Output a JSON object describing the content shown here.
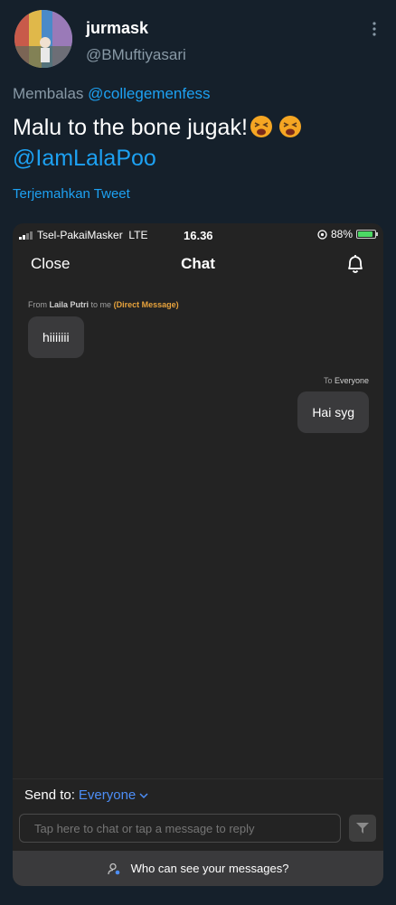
{
  "tweet": {
    "author_name": "jurmask",
    "author_handle": "@BMuftiyasari",
    "reply_prefix": "Membalas",
    "reply_to": "@collegemenfess",
    "text": "Malu to the bone jugak!",
    "emoji_icon": "tired-face-emoji",
    "mention": "@IamLalaPoo",
    "translate_label": "Terjemahkan Tweet"
  },
  "screenshot": {
    "status_bar": {
      "carrier": "Tsel-PakaiMasker",
      "network": "LTE",
      "time": "16.36",
      "battery": "88%",
      "battery_level": 0.88
    },
    "header": {
      "close_label": "Close",
      "title": "Chat"
    },
    "messages": [
      {
        "meta_prefix": "From",
        "meta_from": "Laila Putri",
        "meta_mid": "to me",
        "meta_tag": "(Direct Message)",
        "text": "hiiiiiii"
      },
      {
        "meta_prefix": "To",
        "meta_to": "Everyone",
        "text": "Hai syg"
      }
    ],
    "send_to_label": "Send to:",
    "send_to_value": "Everyone",
    "input_placeholder": "Tap here to chat or tap a message to reply",
    "privacy_label": "Who can see your messages?"
  },
  "colors": {
    "background": "#15202b",
    "link": "#1da1f2",
    "muted": "#8899a6",
    "zoom_accent": "#4d8ef7",
    "dm_tag": "#e8a33c"
  }
}
